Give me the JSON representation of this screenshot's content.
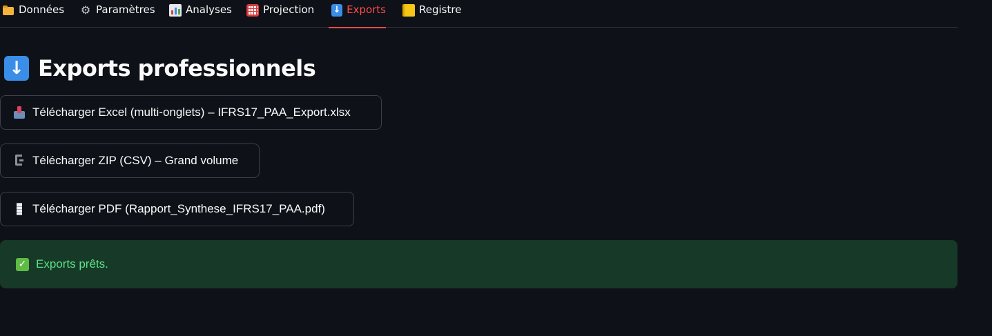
{
  "tabs": [
    {
      "label": "Données",
      "icon": "folder-icon"
    },
    {
      "label": "Paramètres",
      "icon": "gear-icon"
    },
    {
      "label": "Analyses",
      "icon": "bar-chart-icon"
    },
    {
      "label": "Projection",
      "icon": "abacus-icon"
    },
    {
      "label": "Exports",
      "icon": "down-arrow-icon",
      "active": true
    },
    {
      "label": "Registre",
      "icon": "ledger-icon"
    }
  ],
  "page": {
    "title": "Exports professionnels",
    "title_icon": "down-arrow-icon"
  },
  "downloads": [
    {
      "label": "Télécharger Excel (multi-onglets) – IFRS17_PAA_Export.xlsx",
      "icon": "inbox-tray-icon"
    },
    {
      "label": "Télécharger ZIP (CSV) – Grand volume",
      "icon": "clamp-icon"
    },
    {
      "label": "Télécharger PDF (Rapport_Synthese_IFRS17_PAA.pdf)",
      "icon": "page-icon"
    }
  ],
  "alert": {
    "message": "Exports prêts.",
    "icon": "check-mark-icon"
  },
  "colors": {
    "background": "#0e1117",
    "accent": "#ff4b4b",
    "success_bg": "#173928",
    "success_text": "#5ce488"
  }
}
